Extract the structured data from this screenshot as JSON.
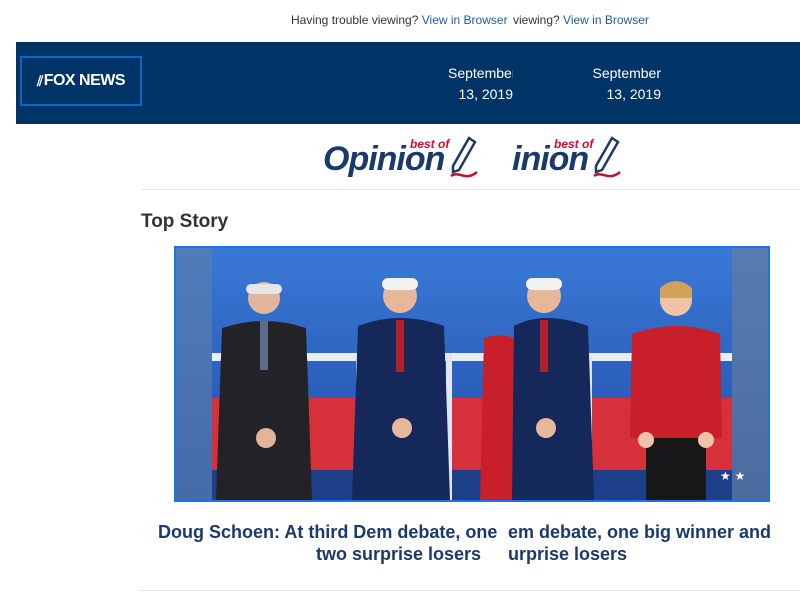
{
  "top_bar": {
    "trouble_text": "Having trouble viewing?",
    "view_link": "View in Browser",
    "trouble_text_dup": "viewing?",
    "view_link_dup": "View in Browser"
  },
  "header": {
    "logo_text": "FOX NEWS",
    "date_a_line1": "September",
    "date_a_line2": "13, 2019",
    "date_b_line1": "September",
    "date_b_line2": "13, 2019"
  },
  "banner": {
    "title": "Opinion",
    "title_dup": "inion",
    "best_of": "best of"
  },
  "section": {
    "title": "Top Story"
  },
  "story": {
    "headline_part1_line1": "Doug Schoen: At third Dem debate, one",
    "headline_part2_line1": "em debate, one big winner and",
    "headline_part1_line2": "two surprise losers",
    "headline_part2_line2": "urprise losers"
  },
  "colors": {
    "header_bg": "#003366",
    "link": "#1a5e9e",
    "headline": "#1b3a6b",
    "accent_red": "#c8102e",
    "border_blue": "#1a73e8"
  }
}
